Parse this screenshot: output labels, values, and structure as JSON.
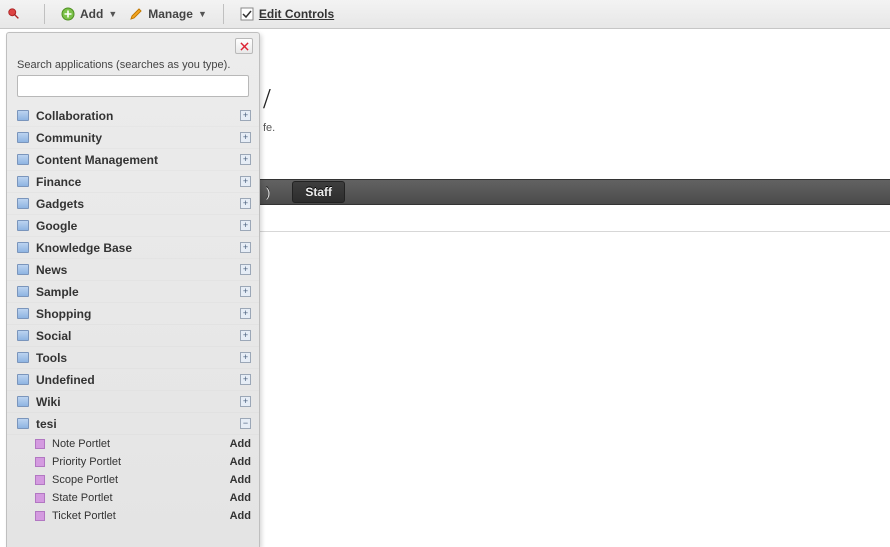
{
  "toolbar": {
    "add_label": "Add",
    "manage_label": "Manage",
    "edit_controls_label": "Edit Controls"
  },
  "page": {
    "title_fragment": "/",
    "subtitle_fragment": "fe.",
    "nav_fragment": ")",
    "nav_button": "Staff"
  },
  "panel": {
    "search_label": "Search applications (searches as you type).",
    "search_value": "",
    "categories": [
      {
        "label": "Collaboration",
        "expanded": false
      },
      {
        "label": "Community",
        "expanded": false
      },
      {
        "label": "Content Management",
        "expanded": false
      },
      {
        "label": "Finance",
        "expanded": false
      },
      {
        "label": "Gadgets",
        "expanded": false
      },
      {
        "label": "Google",
        "expanded": false
      },
      {
        "label": "Knowledge Base",
        "expanded": false
      },
      {
        "label": "News",
        "expanded": false
      },
      {
        "label": "Sample",
        "expanded": false
      },
      {
        "label": "Shopping",
        "expanded": false
      },
      {
        "label": "Social",
        "expanded": false
      },
      {
        "label": "Tools",
        "expanded": false
      },
      {
        "label": "Undefined",
        "expanded": false
      },
      {
        "label": "Wiki",
        "expanded": false
      },
      {
        "label": "tesi",
        "expanded": true,
        "items": [
          {
            "label": "Note Portlet",
            "action": "Add"
          },
          {
            "label": "Priority Portlet",
            "action": "Add"
          },
          {
            "label": "Scope Portlet",
            "action": "Add"
          },
          {
            "label": "State Portlet",
            "action": "Add"
          },
          {
            "label": "Ticket Portlet",
            "action": "Add"
          }
        ]
      }
    ]
  }
}
